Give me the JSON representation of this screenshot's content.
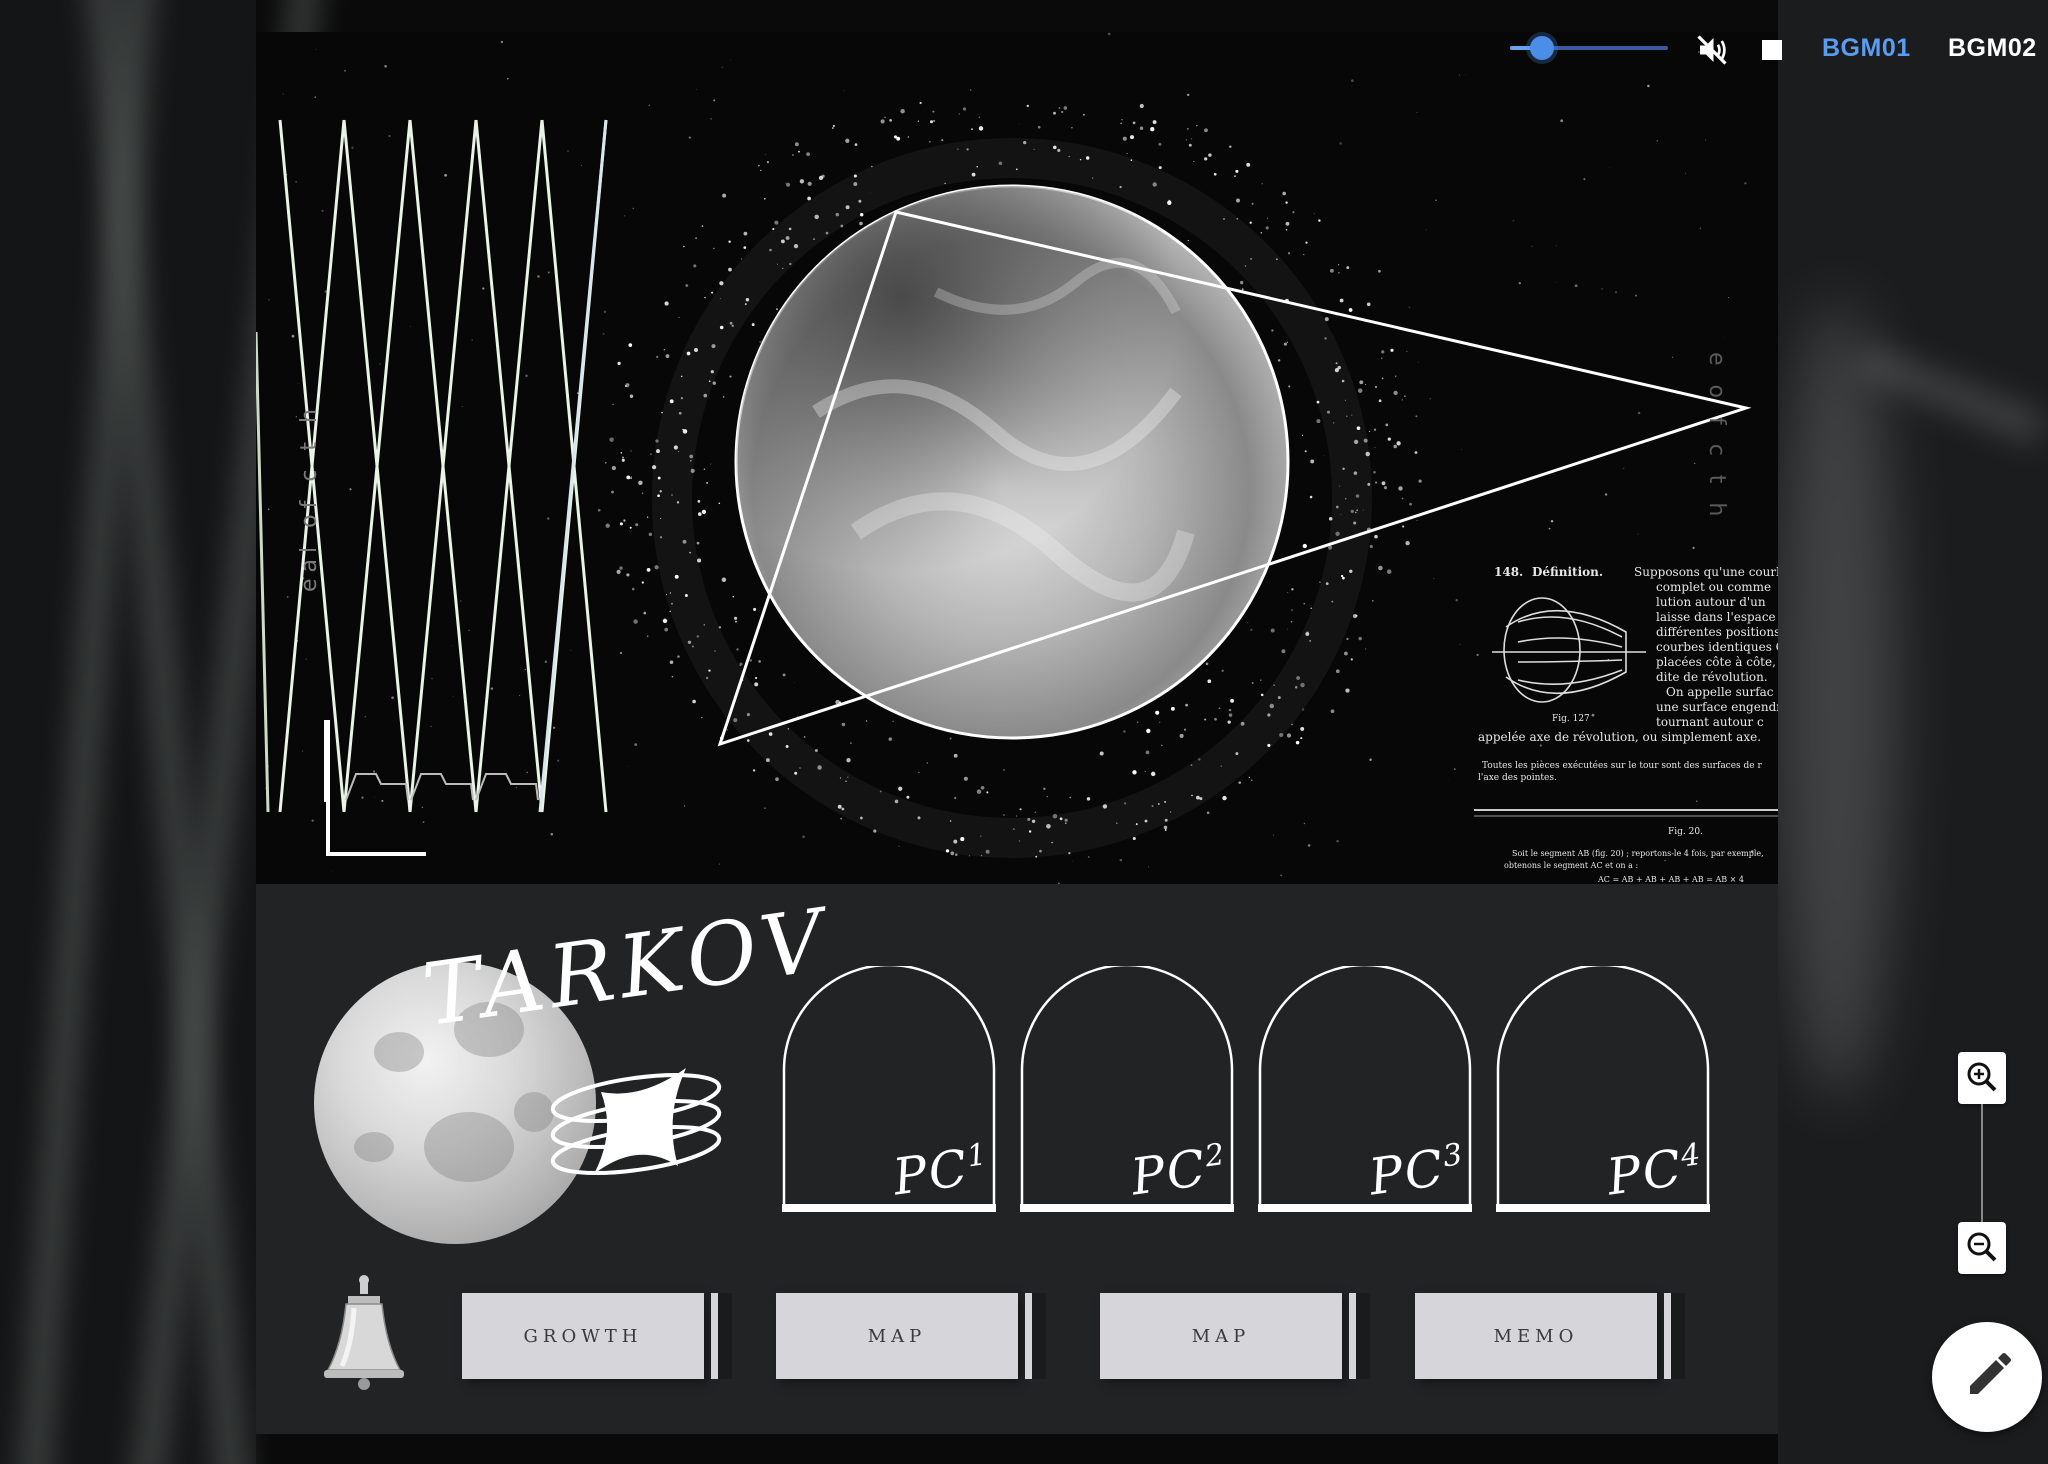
{
  "media": {
    "volume_level": 0.2,
    "mute_icon": "volume-off-icon",
    "stop_icon": "stop-icon",
    "tabs": [
      {
        "label": "BGM01",
        "active": true
      },
      {
        "label": "BGM02",
        "active": false
      }
    ],
    "accent_color": "#5b9cf3"
  },
  "hero": {
    "note_heading_num": "148.",
    "note_heading": "Définition.",
    "note_lines": [
      "Supposons qu'une courb",
      "complet ou comme",
      "lution autour d'un",
      "laisse dans l'espace",
      "différentes positions",
      "courbes identiques C",
      "placées côte à côte, f",
      "dite de révolution.",
      "On appelle surfac",
      "une surface engendr",
      "tournant autour c",
      "appelée axe de révolution, ou simplement axe.",
      "Toutes les pièces exécutées sur le tour sont des surfaces de r",
      "l'axe des pointes."
    ],
    "fig_label": "Fig. 127",
    "fig2_label": "Fig. 20.",
    "footer_lines": [
      "Soit le segment AB (fig. 20) ; reportons-le 4 fois, par exemple,",
      "obtenons le segment AC et on a :",
      "AC = AB + AB + AB + AB = AB × 4"
    ],
    "vertical_text_left": "eal of c t h",
    "vertical_text_right": "e o f c t h"
  },
  "panel": {
    "title": "TARKOV",
    "pc_cards": [
      {
        "label": "PC",
        "num": "1"
      },
      {
        "label": "PC",
        "num": "2"
      },
      {
        "label": "PC",
        "num": "3"
      },
      {
        "label": "PC",
        "num": "4"
      }
    ],
    "buttons": [
      {
        "label": "GROWTH"
      },
      {
        "label": "MAP"
      },
      {
        "label": "MAP"
      },
      {
        "label": "MEMO"
      }
    ]
  },
  "controls": {
    "zoom_in_icon": "zoom-in-icon",
    "zoom_out_icon": "zoom-out-icon",
    "edit_icon": "pencil-icon"
  }
}
